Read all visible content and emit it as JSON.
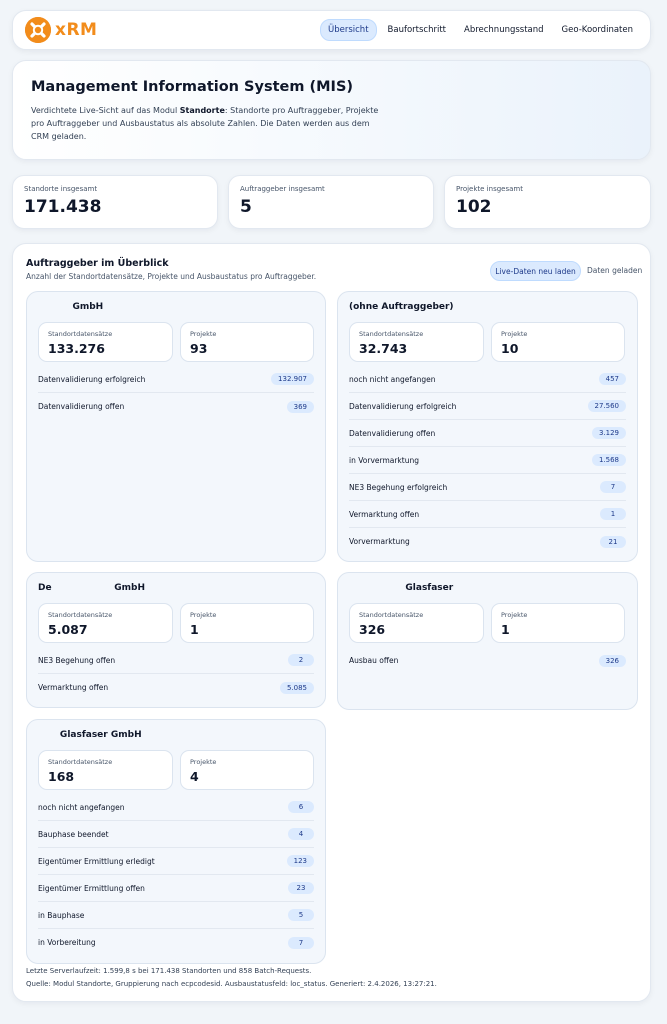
{
  "nav": {
    "logo_text": "xRM",
    "tabs": [
      {
        "label": "Übersicht",
        "active": true
      },
      {
        "label": "Baufortschritt",
        "active": false
      },
      {
        "label": "Abrechnungsstand",
        "active": false
      },
      {
        "label": "Geo-Koordinaten",
        "active": false
      }
    ]
  },
  "hero": {
    "title": "Management Information System (MIS)",
    "desc_part1": "Verdichtete Live-Sicht auf das Modul ",
    "desc_bold": "Standorte",
    "desc_part2": ": Standorte pro Auftraggeber, Projekte pro Auftraggeber und Ausbaustatus als absolute Zahlen. Die Daten werden aus dem CRM geladen."
  },
  "kpis": [
    {
      "label": "Standorte insgesamt",
      "value": "171.438"
    },
    {
      "label": "Auftraggeber insgesamt",
      "value": "5"
    },
    {
      "label": "Projekte insgesamt",
      "value": "102"
    }
  ],
  "overview": {
    "title": "Auftraggeber im Überblick",
    "subtitle": "Anzahl der Standortdatensätze, Projekte und Ausbaustatus pro Auftraggeber.",
    "reload_label": "Live-Daten neu laden",
    "status_label": "Daten geladen",
    "standort_label": "Standortdatensätze",
    "projekte_label": "Projekte"
  },
  "cards": [
    {
      "name": "           GmbH",
      "standorte": "133.276",
      "projekte": "93",
      "rows": [
        {
          "label": "Datenvalidierung erfolgreich",
          "value": "132.907"
        },
        {
          "label": "Datenvalidierung offen",
          "value": "369"
        }
      ]
    },
    {
      "name": "(ohne Auftraggeber)",
      "standorte": "32.743",
      "projekte": "10",
      "rows": [
        {
          "label": "noch nicht angefangen",
          "value": "457"
        },
        {
          "label": "Datenvalidierung erfolgreich",
          "value": "27.560"
        },
        {
          "label": "Datenvalidierung offen",
          "value": "3.129"
        },
        {
          "label": "in Vorvermarktung",
          "value": "1.568"
        },
        {
          "label": "NE3 Begehung erfolgreich",
          "value": "7"
        },
        {
          "label": "Vermarktung offen",
          "value": "1"
        },
        {
          "label": "Vorvermarktung",
          "value": "21"
        }
      ]
    },
    {
      "name": "De                    GmbH",
      "standorte": "5.087",
      "projekte": "1",
      "rows": [
        {
          "label": "NE3 Begehung offen",
          "value": "2"
        },
        {
          "label": "Vermarktung offen",
          "value": "5.085"
        }
      ]
    },
    {
      "name": "                  Glasfaser",
      "standorte": "326",
      "projekte": "1",
      "rows": [
        {
          "label": "Ausbau offen",
          "value": "326"
        }
      ]
    },
    {
      "name": "       Glasfaser GmbH",
      "standorte": "168",
      "projekte": "4",
      "rows": [
        {
          "label": "noch nicht angefangen",
          "value": "6"
        },
        {
          "label": "Bauphase beendet",
          "value": "4"
        },
        {
          "label": "Eigentümer Ermittlung erledigt",
          "value": "123"
        },
        {
          "label": "Eigentümer Ermittlung offen",
          "value": "23"
        },
        {
          "label": "in Bauphase",
          "value": "5"
        },
        {
          "label": "in Vorbereitung",
          "value": "7"
        }
      ]
    }
  ],
  "footer": {
    "line1": "Letzte Serverlaufzeit: 1.599,8 s bei 171.438 Standorten und 858 Batch-Requests.",
    "line2": "Quelle: Modul Standorte, Gruppierung nach ecpcodesid. Ausbaustatusfeld: loc_status. Generiert: 2.4.2026, 13:27:21."
  }
}
